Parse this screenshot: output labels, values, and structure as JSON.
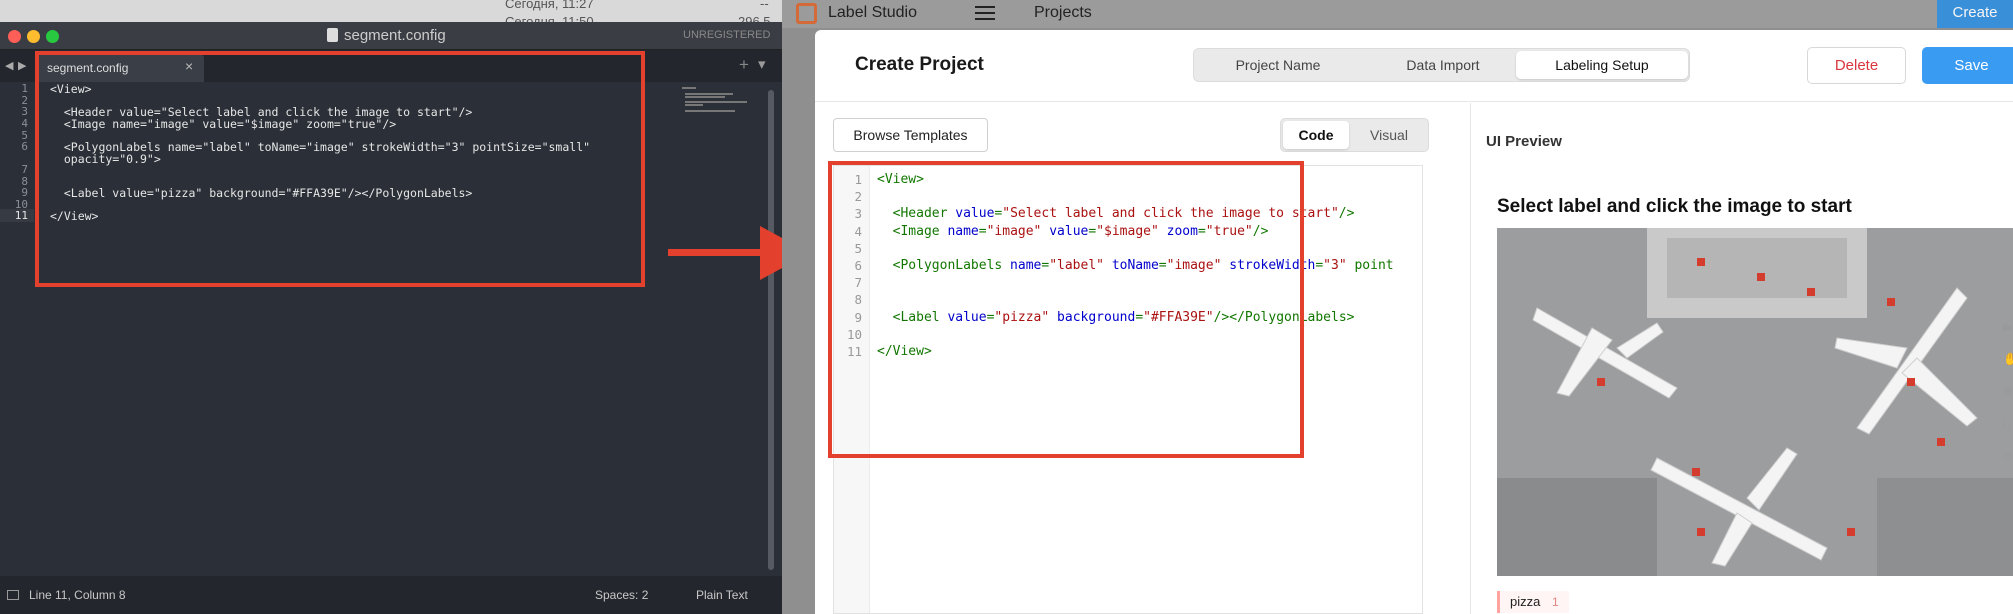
{
  "editor": {
    "finder_strip": {
      "row1": "Сегодня, 11:27",
      "row1_right": "--",
      "row2": "Сегодня, 11:50",
      "row2_right": "296,5"
    },
    "window_title": "segment.config",
    "unregistered": "UNREGISTERED",
    "tab_label": "segment.config",
    "tab_close": "×",
    "new_tab": "+",
    "tab_menu": "▾",
    "lines": [
      {
        "n": "1",
        "text": "<View>"
      },
      {
        "n": "2",
        "text": ""
      },
      {
        "n": "3",
        "text": "  <Header value=\"Select label and click the image to start\"/>"
      },
      {
        "n": "4",
        "text": "  <Image name=\"image\" value=\"$image\" zoom=\"true\"/>"
      },
      {
        "n": "5",
        "text": ""
      },
      {
        "n": "6",
        "text": "  <PolygonLabels name=\"label\" toName=\"image\" strokeWidth=\"3\" pointSize=\"small\""
      },
      {
        "n": "",
        "text": "  opacity=\"0.9\">"
      },
      {
        "n": "7",
        "text": ""
      },
      {
        "n": "8",
        "text": ""
      },
      {
        "n": "9",
        "text": "  <Label value=\"pizza\" background=\"#FFA39E\"/></PolygonLabels>"
      },
      {
        "n": "10",
        "text": ""
      },
      {
        "n": "11",
        "text": "</View>"
      }
    ],
    "status": {
      "position": "Line 11, Column 8",
      "spaces": "Spaces: 2",
      "syntax": "Plain Text"
    }
  },
  "ls": {
    "app_name": "Label Studio",
    "menu_icon": "hamburger-icon",
    "breadcrumb": "Projects",
    "create_button": "Create",
    "dialog": {
      "title": "Create Project",
      "steps": [
        "Project Name",
        "Data Import",
        "Labeling Setup"
      ],
      "active_step": "Labeling Setup",
      "delete": "Delete",
      "save": "Save",
      "browse_templates": "Browse Templates",
      "modes": [
        "Code",
        "Visual"
      ],
      "active_mode": "Code",
      "code_lines": [
        {
          "n": "1",
          "html": "<View>"
        },
        {
          "n": "2",
          "html": ""
        },
        {
          "n": "3",
          "html": "  <Header value=\"Select label and click the image to start\"/>"
        },
        {
          "n": "4",
          "html": "  <Image name=\"image\" value=\"$image\" zoom=\"true\"/>"
        },
        {
          "n": "5",
          "html": ""
        },
        {
          "n": "6",
          "html": "  <PolygonLabels name=\"label\" toName=\"image\" strokeWidth=\"3\" point"
        },
        {
          "n": "7",
          "html": ""
        },
        {
          "n": "8",
          "html": ""
        },
        {
          "n": "9",
          "html": "  <Label value=\"pizza\" background=\"#FFA39E\"/></PolygonLabels>"
        },
        {
          "n": "10",
          "html": ""
        },
        {
          "n": "11",
          "html": "</View>"
        }
      ],
      "ui_preview": "UI Preview",
      "preview_header": "Select label and click the image to start",
      "label_chip": {
        "text": "pizza",
        "count": "1",
        "color": "#FFA39E"
      }
    }
  },
  "colors": {
    "highlight": "#e3402d",
    "save": "#3a9bf2",
    "delete": "#d9363e"
  }
}
